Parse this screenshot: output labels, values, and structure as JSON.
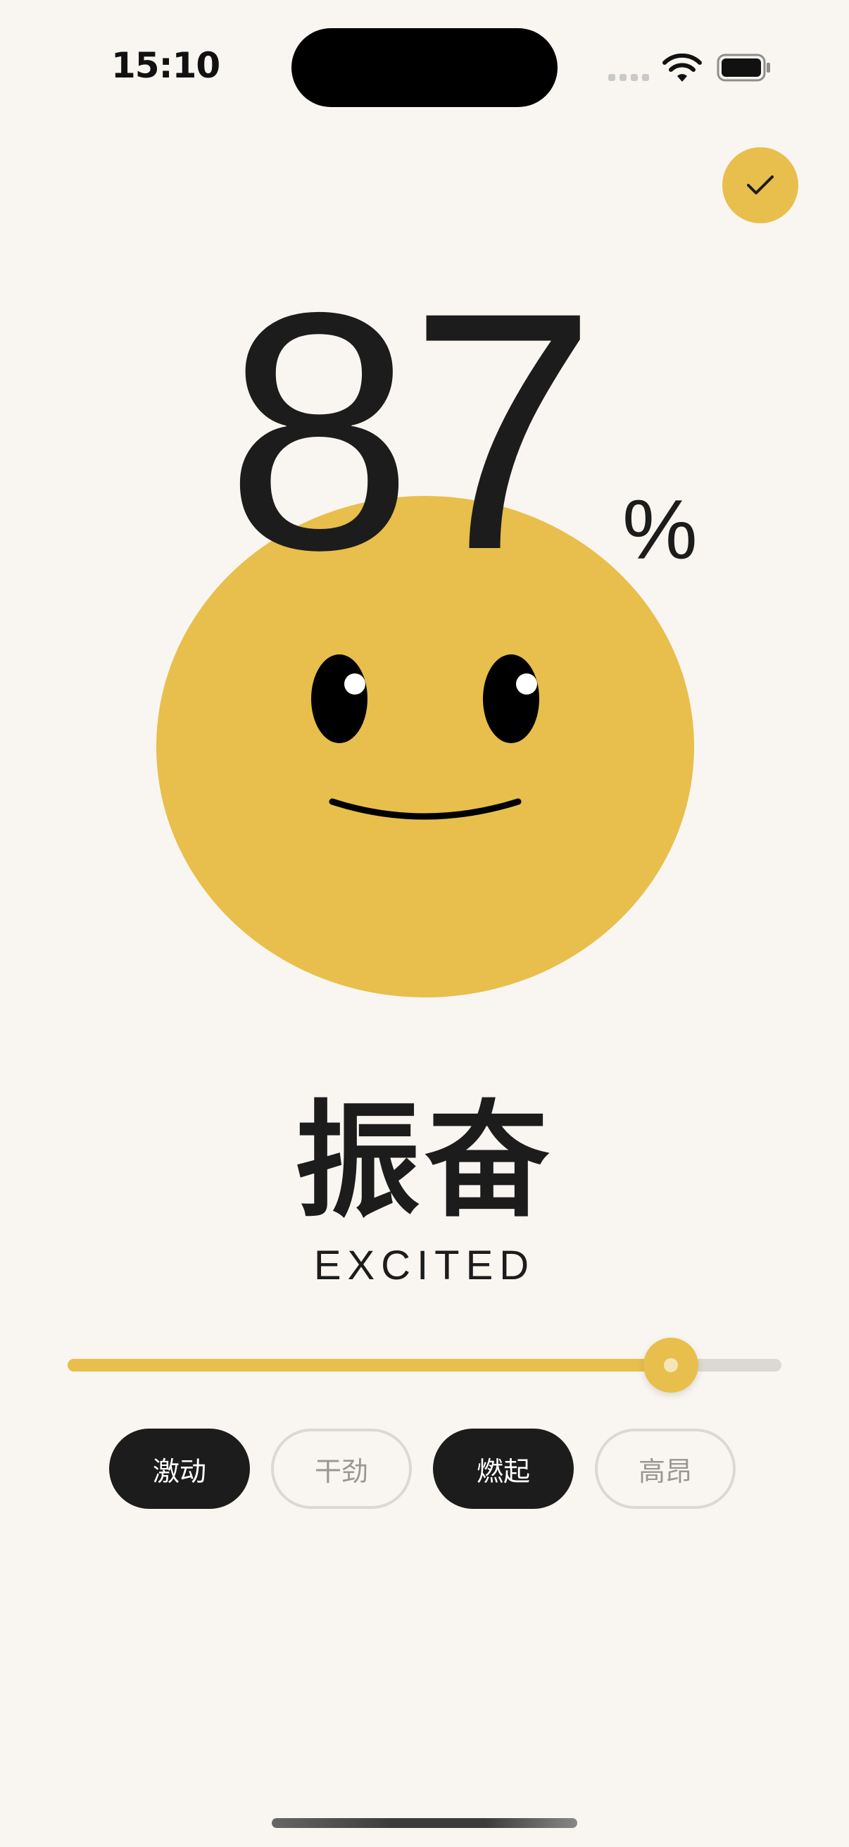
{
  "status_bar": {
    "time": "15:10"
  },
  "confirm_button": {
    "icon": "checkmark-icon"
  },
  "mood": {
    "percent": "87",
    "percent_sign": "%",
    "title": "振奋",
    "subtitle": "EXCITED"
  },
  "slider": {
    "value_fraction": 0.87
  },
  "chips": [
    {
      "label": "激动",
      "selected": true
    },
    {
      "label": "干劲",
      "selected": false
    },
    {
      "label": "燃起",
      "selected": true
    },
    {
      "label": "高昂",
      "selected": false
    }
  ],
  "colors": {
    "background": "#f9f6f1",
    "accent": "#e8bf4c",
    "text": "#1c1c1c",
    "chip_selected": "#1c1c1c",
    "chip_outline": "#dcd9d2"
  }
}
